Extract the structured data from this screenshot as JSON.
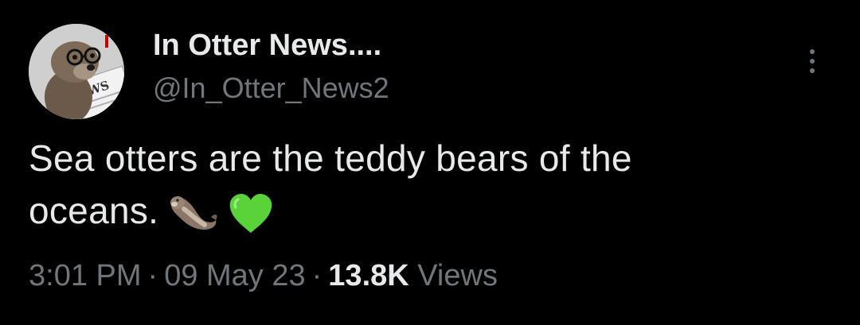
{
  "author": {
    "display_name": "In Otter News....",
    "handle": "@In_Otter_News2",
    "avatar_badge_text": "NEWS"
  },
  "tweet": {
    "text_line1": "Sea otters are the teddy bears of the",
    "text_line2": "oceans.",
    "emojis": [
      "otter-emoji",
      "green-heart-emoji"
    ]
  },
  "meta": {
    "time": "3:01 PM",
    "separator": "·",
    "date": "09 May 23",
    "views_count": "13.8K",
    "views_label": "Views"
  },
  "icons": {
    "more": "more-options-icon"
  },
  "colors": {
    "background": "#000000",
    "primary_text": "#e7e9ea",
    "secondary_text": "#71767b",
    "heart": "#5ad33b"
  }
}
